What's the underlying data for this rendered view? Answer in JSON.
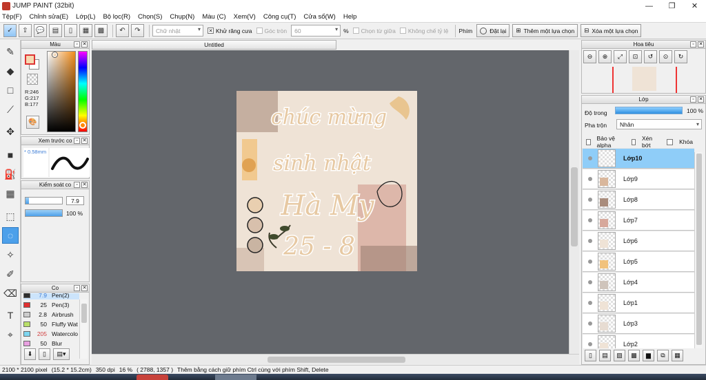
{
  "window": {
    "title": "JUMP PAINT (32bit)",
    "controls": [
      "—",
      "❐",
      "✕"
    ]
  },
  "menu": [
    "Tệp(F)",
    "Chỉnh sửa(E)",
    "Lớp(L)",
    "Bộ lọc(R)",
    "Chọn(S)",
    "Chụp(N)",
    "Màu (C)",
    "Xem(V)",
    "Công cụ(T)",
    "Cửa sổ(W)",
    "Help"
  ],
  "toolbar": {
    "shape_select": "Chữ nhật",
    "antialias_label": "Khử răng cưa",
    "antialias_checked": true,
    "round_corner_label": "Góc tròn",
    "round_corner_value": "60",
    "round_corner_unit": "%",
    "from_center_label": "Chọn từ giữa",
    "keep_ratio_label": "Không chế tỷ lệ",
    "shortcut_label": "Phím",
    "reset_label": "Đặt lại",
    "add_selection_label": "Thêm một lựa chọn",
    "remove_selection_label": "Xóa một lựa chọn"
  },
  "color_panel": {
    "title": "Màu",
    "r": "R:246",
    "g": "G:217",
    "b": "B:177",
    "fg_color": "#f6d9b1"
  },
  "brush_preview": {
    "title": "Xem trước co",
    "size": "* 0.58mm"
  },
  "brush_control": {
    "title": "Kiểm soát co",
    "size_value": "7.9",
    "size_fraction": 0.1,
    "opacity_value": "100 %",
    "opacity_fraction": 1.0
  },
  "brush_list": {
    "title": "Co",
    "items": [
      {
        "num": "7.9",
        "name": "Pen(2)",
        "color": "#2f2f2f",
        "num_color": "#3a7bd5",
        "selected": true
      },
      {
        "num": "25",
        "name": "Pen(3)",
        "color": "#e03030",
        "num_color": "#111111",
        "selected": false
      },
      {
        "num": "2.8",
        "name": "Airbrush",
        "color": "#cccccc",
        "num_color": "#111111",
        "selected": false
      },
      {
        "num": "50",
        "name": "Fluffy Wat",
        "color": "#b9e06a",
        "num_color": "#111111",
        "selected": false
      },
      {
        "num": "205",
        "name": "Watercolo",
        "color": "#7ed6f0",
        "num_color": "#d04040",
        "selected": false
      },
      {
        "num": "50",
        "name": "Blur",
        "color": "#e8a0e0",
        "num_color": "#111111",
        "selected": false
      }
    ]
  },
  "document": {
    "tab_title": "Untitled",
    "artwork_lines": [
      "chúc mừng",
      "sinh nhật",
      "Hà My",
      "25 - 8"
    ]
  },
  "navigator": {
    "title": "Hoa tiêu"
  },
  "layers": {
    "title": "Lớp",
    "opacity_label": "Độ trong",
    "opacity_value": "100 %",
    "blend_label": "Pha trộn",
    "blend_value": "Nhân",
    "protect_alpha": "Bảo vệ alpha",
    "clip_label": "Xén bớt",
    "lock_label": "Khóa",
    "items": [
      {
        "name": "Lớp10",
        "selected": true
      },
      {
        "name": "Lớp9",
        "selected": false
      },
      {
        "name": "Lớp8",
        "selected": false
      },
      {
        "name": "Lớp7",
        "selected": false
      },
      {
        "name": "Lớp6",
        "selected": false
      },
      {
        "name": "Lớp5",
        "selected": false
      },
      {
        "name": "Lớp4",
        "selected": false
      },
      {
        "name": "Lớp1",
        "selected": false
      },
      {
        "name": "Lớp3",
        "selected": false
      },
      {
        "name": "Lớp2",
        "selected": false
      }
    ]
  },
  "status": {
    "size": "2100 * 2100 pixel",
    "physical": "(15.2 * 15.2cm)",
    "dpi": "350 dpi",
    "zoom": "16 %",
    "coords": "( 2788, 1357 )",
    "hint": "Thêm bằng cách giữ phím Ctrl cùng với phím Shift, Delete"
  }
}
